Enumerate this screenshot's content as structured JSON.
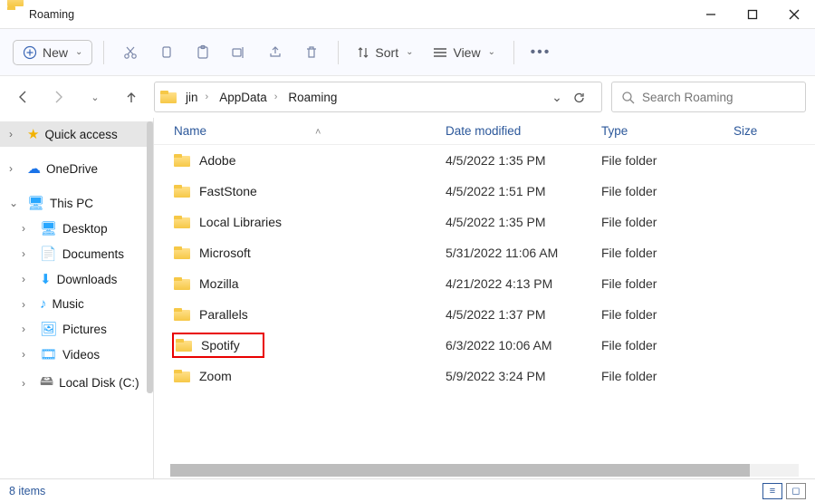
{
  "window": {
    "title": "Roaming"
  },
  "toolbar": {
    "new_label": "New",
    "sort_label": "Sort",
    "view_label": "View"
  },
  "breadcrumbs": {
    "b0": "jin",
    "b1": "AppData",
    "b2": "Roaming"
  },
  "search": {
    "placeholder": "Search Roaming"
  },
  "nav": {
    "quick_access": "Quick access",
    "onedrive": "OneDrive",
    "this_pc": "This PC",
    "desktop": "Desktop",
    "documents": "Documents",
    "downloads": "Downloads",
    "music": "Music",
    "pictures": "Pictures",
    "videos": "Videos",
    "local_disk": "Local Disk (C:)"
  },
  "columns": {
    "name": "Name",
    "date": "Date modified",
    "type": "Type",
    "size": "Size"
  },
  "rows": [
    {
      "name": "Adobe",
      "date": "4/5/2022 1:35 PM",
      "type": "File folder",
      "highlight": false
    },
    {
      "name": "FastStone",
      "date": "4/5/2022 1:51 PM",
      "type": "File folder",
      "highlight": false
    },
    {
      "name": "Local Libraries",
      "date": "4/5/2022 1:35 PM",
      "type": "File folder",
      "highlight": false
    },
    {
      "name": "Microsoft",
      "date": "5/31/2022 11:06 AM",
      "type": "File folder",
      "highlight": false
    },
    {
      "name": "Mozilla",
      "date": "4/21/2022 4:13 PM",
      "type": "File folder",
      "highlight": false
    },
    {
      "name": "Parallels",
      "date": "4/5/2022 1:37 PM",
      "type": "File folder",
      "highlight": false
    },
    {
      "name": "Spotify",
      "date": "6/3/2022 10:06 AM",
      "type": "File folder",
      "highlight": true
    },
    {
      "name": "Zoom",
      "date": "5/9/2022 3:24 PM",
      "type": "File folder",
      "highlight": false
    }
  ],
  "status": {
    "count": "8 items"
  }
}
